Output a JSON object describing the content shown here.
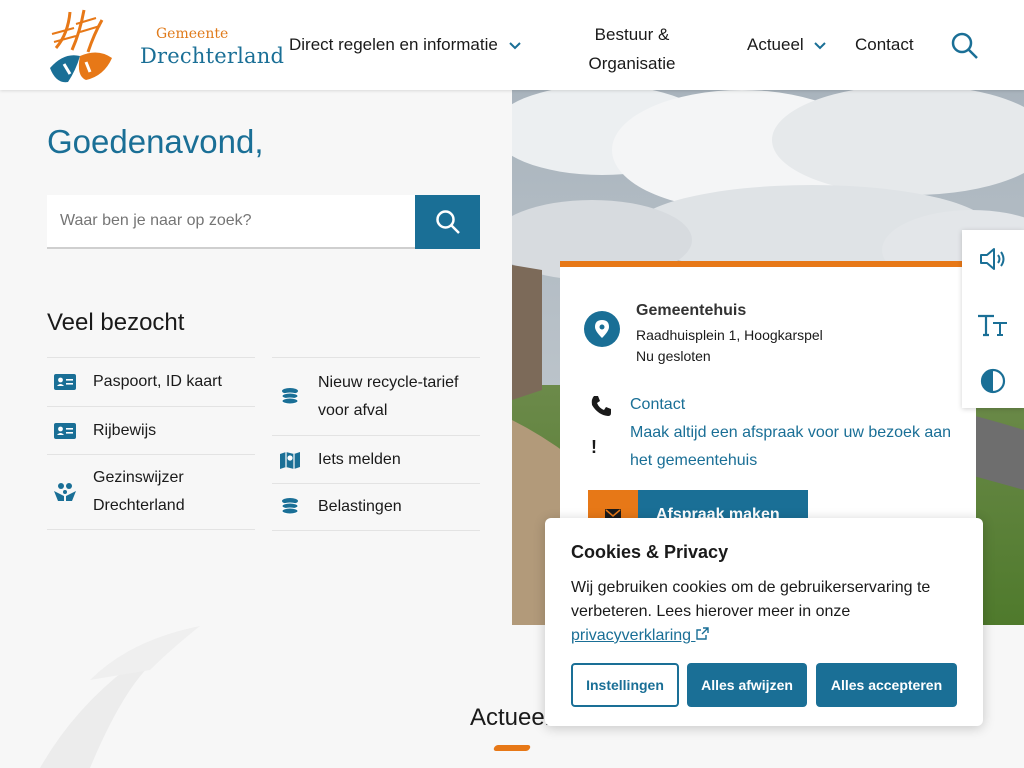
{
  "brand": {
    "small": "Gemeente",
    "name": "Drechterland"
  },
  "nav": {
    "item1": "Direct regelen en informatie",
    "item2_line1": "Bestuur &",
    "item2_line2": "Organisatie",
    "item3": "Actueel",
    "item4": "Contact"
  },
  "hero": {
    "greeting": "Goedenavond,",
    "search_placeholder": "Waar ben je naar op zoek?"
  },
  "popular": {
    "title": "Veel bezocht",
    "col1": [
      {
        "label": "Paspoort, ID kaart",
        "icon": "id-card-icon"
      },
      {
        "label": "Rijbewijs",
        "icon": "id-card-icon"
      },
      {
        "label": "Gezinswijzer Drechterland",
        "icon": "family-hands-icon"
      }
    ],
    "col2": [
      {
        "label": "Nieuw recycle-tarief voor afval",
        "icon": "coins-icon"
      },
      {
        "label": "Iets melden",
        "icon": "map-icon"
      },
      {
        "label": "Belastingen",
        "icon": "coins-icon"
      }
    ]
  },
  "card": {
    "title": "Gemeentehuis",
    "address": "Raadhuisplein 1, Hoogkarspel",
    "status": "Nu gesloten",
    "contact": "Contact",
    "note": "Maak altijd een afspraak voor uw bezoek aan het gemeentehuis",
    "button": "Afspraak maken"
  },
  "cookie": {
    "title": "Cookies & Privacy",
    "text": "Wij gebruiken cookies om de gebruikerservaring te verbeteren. Lees hierover meer in onze ",
    "link": "privacyverklaring",
    "settings": "Instellingen",
    "reject": "Alles afwijzen",
    "accept": "Alles accepteren"
  },
  "news": {
    "title": "Actueel"
  },
  "colors": {
    "primary": "#1a6f96",
    "accent": "#e77817"
  }
}
